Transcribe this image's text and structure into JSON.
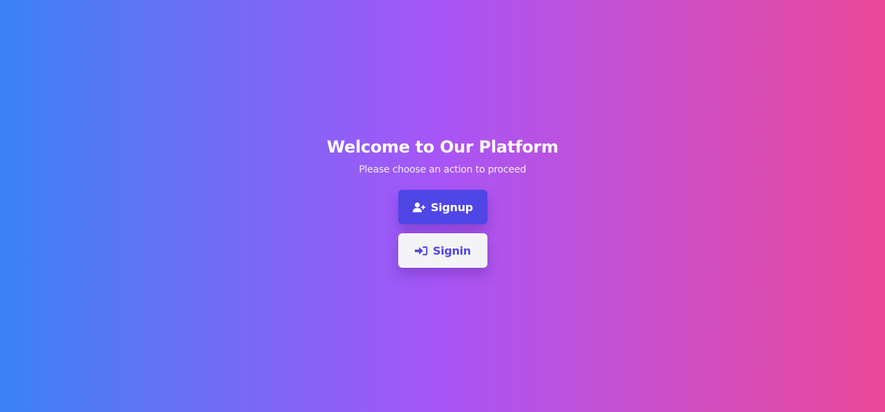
{
  "welcome": {
    "title": "Welcome to Our Platform",
    "subtitle": "Please choose an action to proceed"
  },
  "actions": {
    "signup": {
      "label": "Signup",
      "icon": "user-plus-icon"
    },
    "signin": {
      "label": "Signin",
      "icon": "sign-in-icon"
    }
  },
  "colors": {
    "gradient_start": "#3b82f6",
    "gradient_mid": "#a855f7",
    "gradient_end": "#ec4899",
    "primary": "#4f46e5",
    "secondary_bg": "#f4f4f6"
  }
}
